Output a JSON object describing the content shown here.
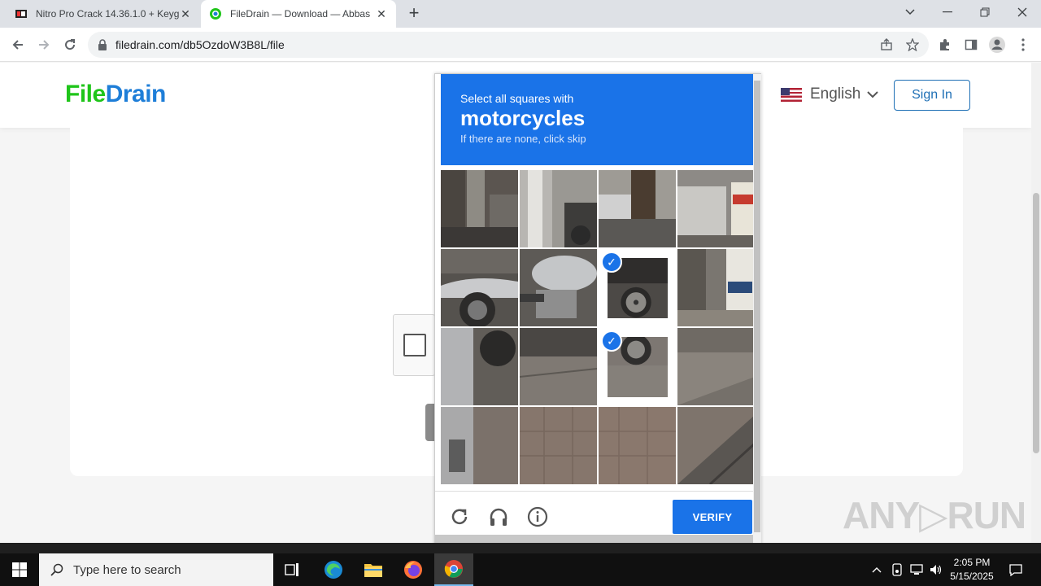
{
  "browser": {
    "tabs": [
      {
        "title": "Nitro Pro Crack 14.36.1.0 + Keyg",
        "close": "✕"
      },
      {
        "title": "FileDrain — Download — Abbas",
        "close": "✕"
      }
    ],
    "new_tab": "+",
    "address": "filedrain.com/db5OzdoW3B8L/file"
  },
  "site": {
    "logo_part1": "File",
    "logo_part2": "Drain",
    "language": "English",
    "signin": "Sign In"
  },
  "captcha": {
    "instruction": "Select all squares with",
    "target": "motorcycles",
    "hint": "If there are none, click skip",
    "verify": "VERIFY",
    "selected_tiles": [
      6,
      10
    ],
    "accent_color": "#1a73e8"
  },
  "watermark": "ANY▷RUN",
  "taskbar": {
    "search_placeholder": "Type here to search",
    "time": "2:05 PM",
    "date": "5/15/2025"
  }
}
